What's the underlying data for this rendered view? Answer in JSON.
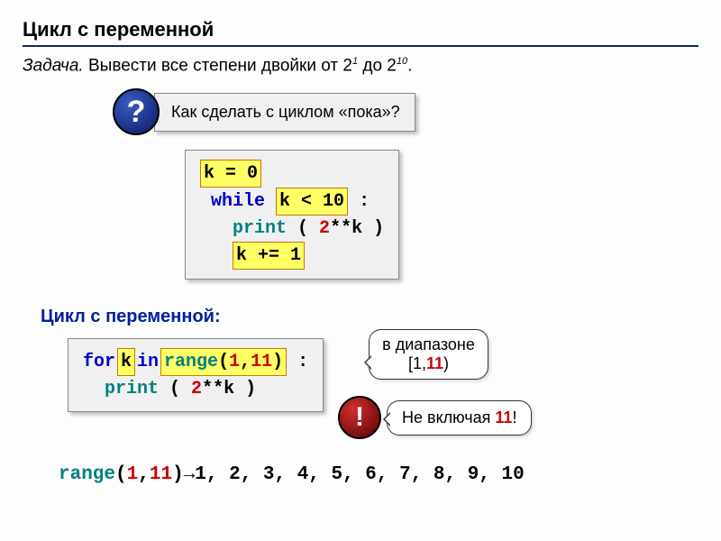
{
  "title": "Цикл с переменной",
  "task_prefix": "Задача.",
  "task_rest_1": " Вывести все степени двойки от 2",
  "task_sup1": "1",
  "task_rest_2": " до 2",
  "task_sup2": "10",
  "task_rest_3": ".",
  "q_mark": "?",
  "q_text": "Как сделать с циклом «пока»?",
  "code_while": {
    "l1_hl": "k = 0",
    "l2_kw": "while",
    "l2_hl": "k < 10",
    "l2_colon": ":",
    "l3_kw": "print",
    "l3_paren_open": " ( ",
    "l3_expr_num": "2",
    "l3_expr_rest": "**k",
    "l3_paren_close": " )",
    "l4_hl": "k += 1"
  },
  "section_label": "Цикл с переменной:",
  "code_for": {
    "l1_for": "for",
    "l1_k": " k ",
    "l1_in": "in",
    "l1_range": " range",
    "l1_open": "(",
    "l1_a": "1",
    "l1_comma": ",",
    "l1_b": "11",
    "l1_close": ")",
    "l1_colon": " :",
    "l2_kw": "print",
    "l2_paren_open": " ( ",
    "l2_expr_num": "2",
    "l2_expr_rest": "**k",
    "l2_paren_close": " )"
  },
  "speech_range_l1": "в диапазоне",
  "speech_range_l2_a": "[1,",
  "speech_range_l2_b": "11",
  "speech_range_l2_c": ")",
  "excl_mark": "!",
  "speech_excl_a": "Не включая ",
  "speech_excl_b": "11",
  "speech_excl_c": "!",
  "range_line": {
    "range_word": "range",
    "open": "(",
    "a": "1",
    "comma": ",",
    "b": "11",
    "close": ")",
    "arrow": " → ",
    "out": "1, 2, 3, 4, 5, 6, 7, 8, 9, 10"
  },
  "chart_data": {
    "type": "table",
    "title": "Цикл с переменной — степени двойки",
    "while_loop": {
      "init": "k = 0",
      "condition": "k < 10",
      "body": "print(2**k)",
      "step": "k += 1"
    },
    "for_loop": {
      "statement": "for k in range(1, 11):",
      "body": "print(2**k)",
      "range_start": 1,
      "range_stop": 11,
      "iterates_over": [
        1,
        2,
        3,
        4,
        5,
        6,
        7,
        8,
        9,
        10
      ],
      "note": "в диапазоне [1,11) — не включая 11"
    }
  }
}
